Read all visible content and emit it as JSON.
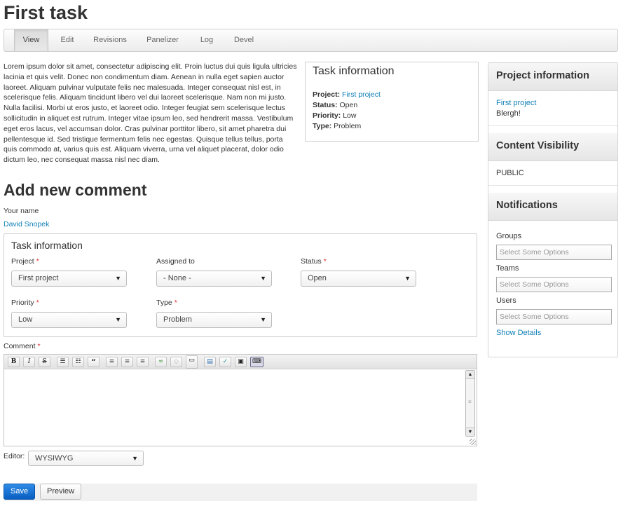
{
  "page": {
    "title": "First task"
  },
  "tabs": [
    "View",
    "Edit",
    "Revisions",
    "Panelizer",
    "Log",
    "Devel"
  ],
  "body_text": "Lorem ipsum dolor sit amet, consectetur adipiscing elit. Proin luctus dui quis ligula ultricies lacinia et quis velit. Donec non condimentum diam. Aenean in nulla eget sapien auctor laoreet. Aliquam pulvinar vulputate felis nec malesuada. Integer consequat nisl est, in scelerisque felis. Aliquam tincidunt libero vel dui laoreet scelerisque. Nam non mi justo. Nulla facilisi. Morbi ut eros justo, et laoreet odio. Integer feugiat sem scelerisque lectus sollicitudin in aliquet est rutrum. Integer vitae ipsum leo, sed hendrerit massa. Vestibulum eget eros lacus, vel accumsan dolor. Cras pulvinar porttitor libero, sit amet pharetra dui pellentesque id. Sed tristique fermentum felis nec egestas. Quisque tellus tellus, porta quis commodo at, varius quis est. Aliquam viverra, urna vel aliquet placerat, dolor odio dictum leo, nec consequat massa nisl nec diam.",
  "task_info": {
    "title": "Task information",
    "project_label": "Project:",
    "project_value": "First project",
    "status_label": "Status:",
    "status_value": "Open",
    "priority_label": "Priority:",
    "priority_value": "Low",
    "type_label": "Type:",
    "type_value": "Problem"
  },
  "comment_form": {
    "heading": "Add new comment",
    "your_name_label": "Your name",
    "your_name_value": "David Snopek",
    "fieldset_title": "Task information",
    "required_mark": "*",
    "project": {
      "label": "Project",
      "value": "First project"
    },
    "assigned_to": {
      "label": "Assigned to",
      "value": "- None -"
    },
    "status": {
      "label": "Status",
      "value": "Open"
    },
    "priority": {
      "label": "Priority",
      "value": "Low"
    },
    "type": {
      "label": "Type",
      "value": "Problem"
    },
    "comment_label": "Comment",
    "editor_label": "Editor:",
    "editor_value": "WYSIWYG",
    "toolbar": {
      "bold": "B",
      "italic": "I",
      "strike": "S",
      "bullet_list": "☰",
      "numbered_list": "☷",
      "blockquote": "“",
      "align_left": "≡",
      "align_center": "≡",
      "align_right": "≡",
      "link": "∞",
      "unlink": "◇",
      "break": "▭",
      "template": "▤",
      "spellcheck": "✓",
      "image": "▣",
      "source": "⌨"
    },
    "save_label": "Save",
    "preview_label": "Preview"
  },
  "sidebar": {
    "project_info_title": "Project information",
    "project_link": "First project",
    "project_desc": "Blergh!",
    "visibility_title": "Content Visibility",
    "visibility_value": "PUBLIC",
    "notifications_title": "Notifications",
    "groups_label": "Groups",
    "groups_placeholder": "Select Some Options",
    "teams_label": "Teams",
    "teams_placeholder": "Select Some Options",
    "users_label": "Users",
    "users_placeholder": "Select Some Options",
    "show_details": "Show Details"
  },
  "colors": {
    "link": "#0f7fb6",
    "required": "#e03030",
    "primary_button": "#1670d6"
  }
}
